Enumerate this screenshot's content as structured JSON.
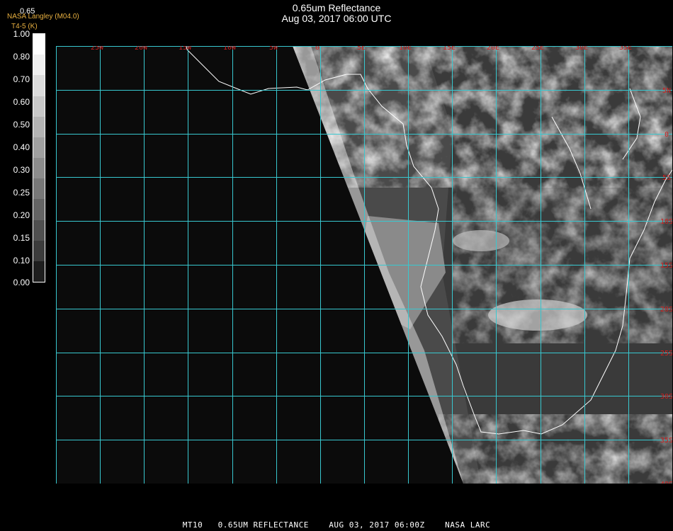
{
  "title": {
    "line1": "0.65um Reflectance",
    "line2": "Aug 03, 2017 06:00 UTC"
  },
  "credit": {
    "line1": "0.65",
    "line2": "NASA Langley (M04.0)",
    "line3": "T4-5 (K)"
  },
  "colorbar": {
    "labels": [
      "1.00",
      "0.80",
      "0.70",
      "0.60",
      "0.50",
      "0.40",
      "0.30",
      "0.25",
      "0.20",
      "0.15",
      "0.10",
      "0.00"
    ],
    "colors": [
      "#ffffff",
      "#f0f0f0",
      "#dcdcdc",
      "#c8c8c8",
      "#b4b4b4",
      "#a0a0a0",
      "#8c8c8c",
      "#787878",
      "#646464",
      "#505050",
      "#3c3c3c",
      "#1e1e1e"
    ]
  },
  "map": {
    "grid_color": "#38c8d0",
    "label_color": "#d02020",
    "lon_labels": [
      "25W",
      "20W",
      "15W",
      "10W",
      "5W",
      "0",
      "5E",
      "10E",
      "15E",
      "20E",
      "25E",
      "30E",
      "35E"
    ],
    "lat_labels": [
      "5N",
      "0",
      "5S",
      "10S",
      "15S",
      "20S",
      "25S",
      "30S",
      "35S",
      "40S"
    ]
  },
  "footer": "MT10   0.65UM REFLECTANCE    AUG 03, 2017 06:00Z    NASA LARC"
}
